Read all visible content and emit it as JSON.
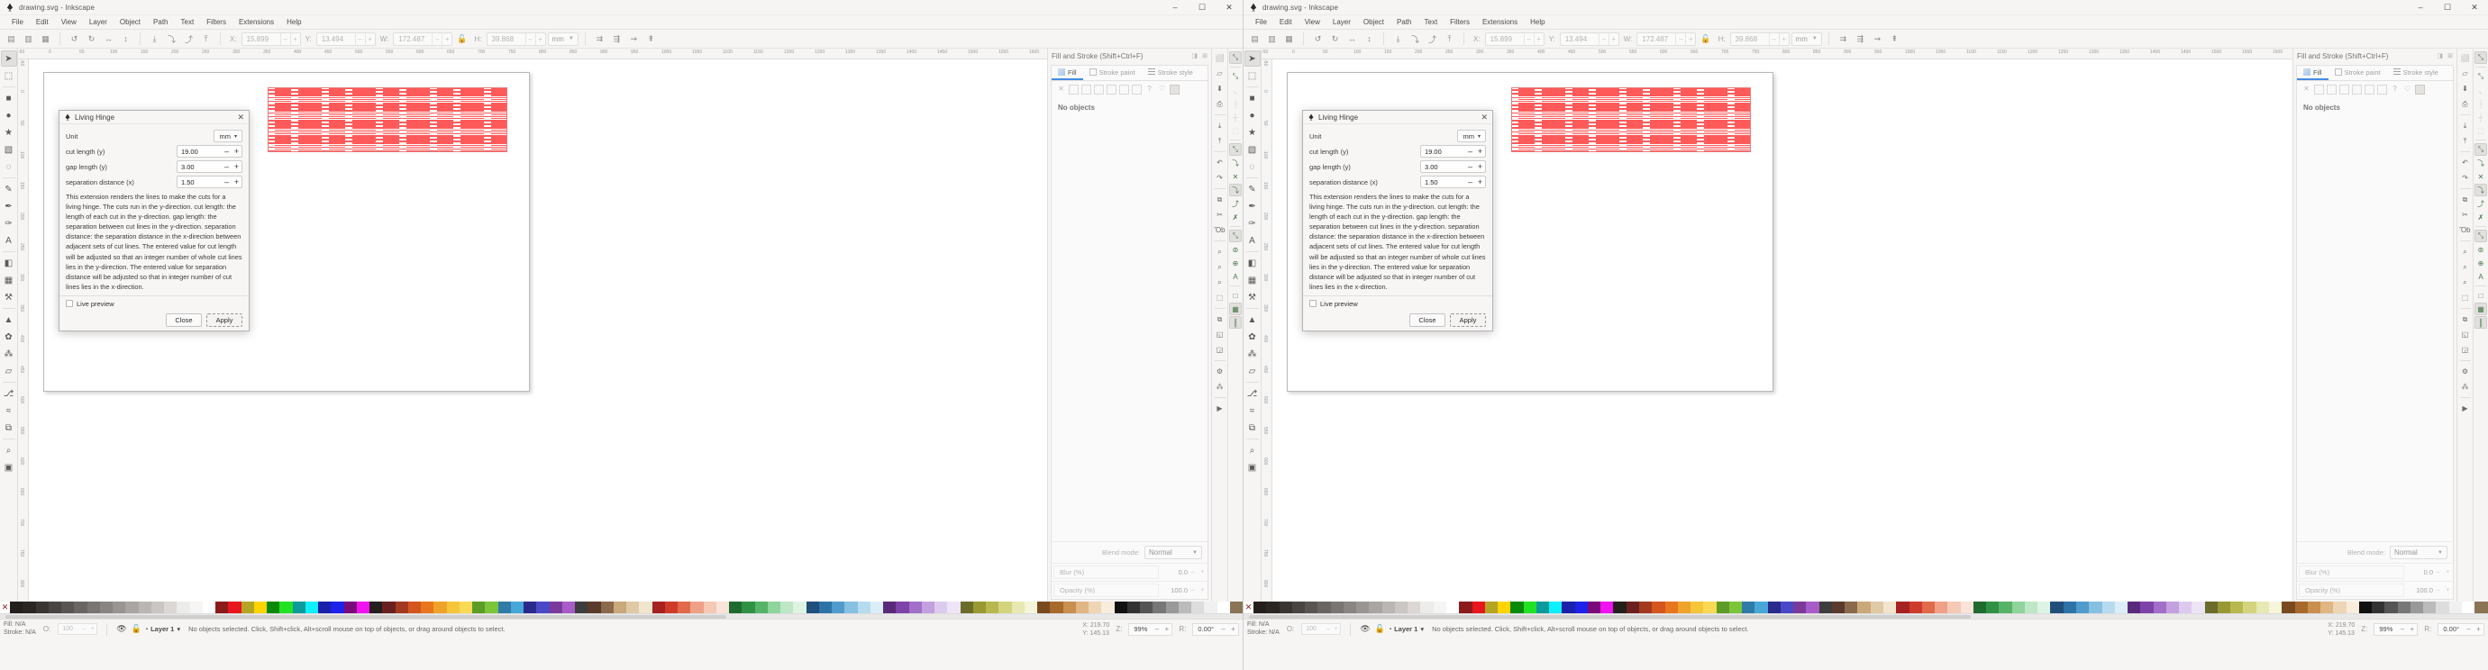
{
  "window": {
    "title": "drawing.svg - Inkscape",
    "app_icon": "inkscape-logo-icon",
    "controls": {
      "minimize": "–",
      "maximize": "☐",
      "close": "✕"
    }
  },
  "menubar": {
    "items": [
      "File",
      "Edit",
      "View",
      "Layer",
      "Object",
      "Path",
      "Text",
      "Filters",
      "Extensions",
      "Help"
    ]
  },
  "commandbar": {
    "x_label": "X:",
    "x_value": "15.899",
    "y_label": "Y:",
    "y_value": "13.494",
    "w_label": "W:",
    "w_value": "172.487",
    "h_label": "H:",
    "h_value": "39.868",
    "unit_value": "mm",
    "lock_icon": "lock-open-icon",
    "minus": "–",
    "plus": "+"
  },
  "toolbox": {
    "items": [
      {
        "name": "selector-tool",
        "glyph": "➤",
        "active": true
      },
      {
        "name": "node-tool",
        "glyph": "⬚"
      },
      {
        "name": "rectangle-tool",
        "glyph": "■"
      },
      {
        "name": "ellipse-tool",
        "glyph": "●"
      },
      {
        "name": "star-tool",
        "glyph": "★"
      },
      {
        "name": "3dbox-tool",
        "glyph": "▧"
      },
      {
        "name": "spiral-tool",
        "glyph": "◌"
      },
      {
        "name": "pencil-tool",
        "glyph": "✎"
      },
      {
        "name": "bezier-tool",
        "glyph": "✒"
      },
      {
        "name": "calligraphy-tool",
        "glyph": "✑"
      },
      {
        "name": "text-tool",
        "glyph": "A"
      },
      {
        "name": "gradient-tool",
        "glyph": "◧"
      },
      {
        "name": "mesh-tool",
        "glyph": "▦"
      },
      {
        "name": "dropper-tool",
        "glyph": "⚒"
      },
      {
        "name": "paintbucket-tool",
        "glyph": "▲"
      },
      {
        "name": "tweak-tool",
        "glyph": "✿"
      },
      {
        "name": "spray-tool",
        "glyph": "⁂"
      },
      {
        "name": "eraser-tool",
        "glyph": "▱"
      },
      {
        "name": "connector-tool",
        "glyph": "⎇"
      },
      {
        "name": "lpe-tool",
        "glyph": "≈"
      },
      {
        "name": "measure-tool",
        "glyph": "⧉"
      },
      {
        "name": "zoom-tool",
        "glyph": "⌕"
      },
      {
        "name": "pages-tool",
        "glyph": "▣"
      }
    ]
  },
  "canvas": {
    "ruler_h_ticks": [
      "-50",
      "0",
      "50",
      "100",
      "150",
      "200",
      "250",
      "300",
      "350"
    ],
    "hinge": {
      "line_color": "#ff5a5a",
      "boundary_color": "#e87a7a",
      "rows": 34,
      "row_spacing_px": 6.3,
      "description": "red living-hinge cut pattern rendered on page"
    }
  },
  "dock": {
    "header_title": "Fill and Stroke (Shift+Ctrl+F)",
    "header_icons": [
      "dock-float-icon",
      "dock-close-icon"
    ],
    "tabs": [
      {
        "label": "Fill",
        "icon": "fill-icon",
        "active": true
      },
      {
        "label": "Stroke paint",
        "icon": "stroke-paint-icon",
        "active": false
      },
      {
        "label": "Stroke style",
        "icon": "stroke-style-icon",
        "active": false
      }
    ],
    "paint_swatches": [
      "no-paint-icon",
      "flat-color-icon",
      "linear-gradient-icon",
      "radial-gradient-icon",
      "pattern-icon",
      "swatch-icon",
      "unknown-icon",
      "question-icon",
      "unset-paint-icon",
      "selected-paint-icon"
    ],
    "no_objects": "No objects",
    "blend_label": "Blend mode:",
    "blend_value": "Normal",
    "blur_label": "Blur (%)",
    "blur_value": "0.0",
    "opacity_label": "Opacity (%)",
    "opacity_value": "100.0",
    "minus": "–",
    "plus": "+"
  },
  "commandcol": {
    "items": [
      {
        "name": "new-document-icon",
        "glyph": "⬜"
      },
      {
        "name": "open-document-icon",
        "glyph": "▱"
      },
      {
        "name": "save-document-icon",
        "glyph": "⬇"
      },
      {
        "name": "print-document-icon",
        "glyph": "⎙"
      },
      {
        "name": "import-icon",
        "glyph": "⤓"
      },
      {
        "name": "export-icon",
        "glyph": "⤒"
      },
      {
        "name": "undo-icon",
        "glyph": "↶"
      },
      {
        "name": "redo-icon",
        "glyph": "↷"
      },
      {
        "name": "copy-icon",
        "glyph": "⧉"
      },
      {
        "name": "cut-icon",
        "glyph": "✂"
      },
      {
        "name": "paste-icon",
        "glyph": "Ὄb"
      },
      {
        "name": "zoom-selection-icon",
        "glyph": "⌕"
      },
      {
        "name": "zoom-drawing-icon",
        "glyph": "⌕"
      },
      {
        "name": "zoom-page-icon",
        "glyph": "⌕"
      },
      {
        "name": "selection-icon",
        "glyph": "⬚"
      },
      {
        "name": "duplicate-icon",
        "glyph": "⧉"
      },
      {
        "name": "group-icon",
        "glyph": "◱"
      },
      {
        "name": "ungroup-icon",
        "glyph": "◲"
      },
      {
        "name": "object-properties-icon",
        "glyph": "⚙"
      },
      {
        "name": "xml-editor-icon",
        "glyph": "⁂"
      },
      {
        "name": "more-icon",
        "glyph": "▶"
      }
    ]
  },
  "snapcol": {
    "items": [
      {
        "name": "enable-snapping-toggle",
        "glyph": "⤡",
        "active": true
      },
      {
        "name": "snap-bounding-box-icon",
        "glyph": "⤡"
      },
      {
        "name": "snap-bbox-corner-icon",
        "glyph": "⌞",
        "dim": true
      },
      {
        "name": "snap-bbox-edge-icon",
        "glyph": "├",
        "dim": true
      },
      {
        "name": "snap-bbox-midpoint-icon",
        "glyph": "┼",
        "dim": true
      },
      {
        "name": "snap-bbox-center-icon",
        "glyph": "⬚",
        "dim": true
      },
      {
        "name": "snap-nodes-icon",
        "glyph": "⤡",
        "active": true
      },
      {
        "name": "snap-paths-icon",
        "glyph": "⤵"
      },
      {
        "name": "snap-path-intersection-icon",
        "glyph": "✕"
      },
      {
        "name": "snap-cusp-nodes-icon",
        "glyph": "⤵",
        "active": true
      },
      {
        "name": "snap-smooth-nodes-icon",
        "glyph": "⤴"
      },
      {
        "name": "snap-midpoints-icon",
        "glyph": "✗"
      },
      {
        "name": "snap-others-icon",
        "glyph": "⤡",
        "active": true
      },
      {
        "name": "snap-object-center-icon",
        "glyph": "⊚"
      },
      {
        "name": "snap-rotation-center-icon",
        "glyph": "⊕"
      },
      {
        "name": "snap-text-baseline-icon",
        "glyph": "A"
      },
      {
        "name": "snap-page-border-icon",
        "glyph": "□"
      },
      {
        "name": "snap-grid-icon",
        "glyph": "▦",
        "active": true
      },
      {
        "name": "snap-guides-icon",
        "glyph": "║",
        "active": true
      }
    ]
  },
  "palette": {
    "none_label": "✕",
    "colors": [
      "#241f1c",
      "#2b2622",
      "#3a3531",
      "#4a4542",
      "#5a5552",
      "#6a6562",
      "#7a7572",
      "#8a8582",
      "#9a9592",
      "#aaa5a2",
      "#bbb6b3",
      "#cbc6c3",
      "#dcd7d4",
      "#ececea",
      "#f6f5f4",
      "#ffffff",
      "#8b1a1a",
      "#e8161d",
      "#b5a524",
      "#ffd400",
      "#0a8a0a",
      "#22e322",
      "#0c9a9a",
      "#0ff0ff",
      "#1a20aa",
      "#1c22e8",
      "#7a0a7a",
      "#f012f0",
      "#241f1c",
      "#6b2020",
      "#a33a1f",
      "#d4561e",
      "#e8761f",
      "#f0a32a",
      "#f6c63a",
      "#fada55",
      "#5d9c27",
      "#7cc43a",
      "#2e7ca8",
      "#47a8d8",
      "#2a2a8c",
      "#4949c8",
      "#7a3a9a",
      "#a85cc8",
      "#3d3d3d",
      "#5a3a2a",
      "#8a6a4a",
      "#c9a87a",
      "#e0c9a6",
      "#f2e5cd",
      "#a62121",
      "#cf3b2b",
      "#e06a4a",
      "#efa187",
      "#f6c9b5",
      "#fae3d8",
      "#1f6b2f",
      "#2f9143",
      "#55b468",
      "#8ed49c",
      "#bde7c6",
      "#dff3e4",
      "#1f4f7a",
      "#2d73a8",
      "#4f9ccc",
      "#86c0e0",
      "#b6dbef",
      "#dbeef8",
      "#5a2a7a",
      "#7e43a8",
      "#a16fc8",
      "#c3a0de",
      "#dccbee",
      "#eee4f7",
      "#6b6b2a",
      "#999933",
      "#b8b84f",
      "#d4d47f",
      "#e8e8b2",
      "#f5f5da",
      "#7a4a1f",
      "#a8692d",
      "#c98f4f",
      "#e0b684",
      "#eed5b5",
      "#f8ecdc",
      "#111111",
      "#333333",
      "#555555",
      "#777777",
      "#999999",
      "#bbbbbb",
      "#dddddd",
      "#f0f0f0",
      "#ffffff",
      "#8b7355"
    ]
  },
  "statusbar": {
    "fill_label": "Fill:",
    "fill_value": "N/A",
    "stroke_label": "Stroke:",
    "stroke_value": "N/A",
    "opacity_label": "O:",
    "opacity_value": "100",
    "hide_icon": "eye-icon",
    "lock_icon": "lock-open-icon",
    "layer_name": "Layer 1",
    "layer_caret": "▾",
    "message": "No objects selected. Click, Shift+click, Alt+scroll mouse on top of objects, or drag around objects to select.",
    "x_label": "X:",
    "x_value": "219.70",
    "y_label": "Y:",
    "y_value": "145.13",
    "z_label": "Z:",
    "zoom_value": "99%",
    "r_label": "R:",
    "rotation_value": "0.00°",
    "minus": "–",
    "plus": "+"
  },
  "dialog": {
    "icon": "inkscape-logo-icon",
    "title": "Living Hinge",
    "close": "✕",
    "fields": [
      {
        "label": "Unit",
        "type": "combo",
        "value": "mm",
        "caret": "▾"
      },
      {
        "label": "cut length (y)",
        "type": "spin",
        "value": "19.00"
      },
      {
        "label": "gap length (y)",
        "type": "spin",
        "value": "3.00"
      },
      {
        "label": "separation distance (x)",
        "type": "spin",
        "value": "1.50"
      }
    ],
    "description": "This extension renders the lines to make the cuts for a living hinge. The cuts run in the y-direction. cut length: the length of each cut in the y-direction. gap length: the separation between cut lines in the y-direction. separation distance: the separation distance in the x-direction between adjacent sets of cut lines. The entered value for cut length will be adjusted so that an integer number of whole cut lines lies in the y-direction. The entered value for separation distance will be adjusted so that in integer number of cut lines lies in the x-direction.",
    "live_preview_label": "Live preview",
    "live_preview_checked": false,
    "close_button": "Close",
    "apply_button": "Apply",
    "minus": "–",
    "plus": "+"
  }
}
